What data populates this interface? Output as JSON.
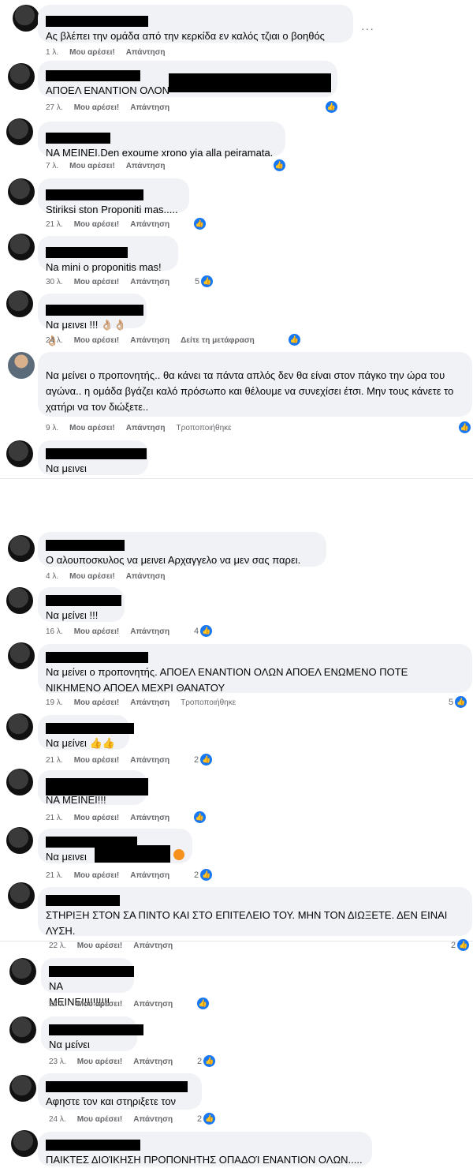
{
  "ui": {
    "like_label": "Μου αρέσει!",
    "reply_label": "Απάντηση",
    "translate_label": "Δείτε τη μετάφραση",
    "edited_label": "Τροποποιήθηκε",
    "more_icon": "···",
    "thumbs_up_icon": "👍"
  },
  "comments": [
    {
      "text": "Ας βλέπει την ομάδα από την κερκίδα εν καλός τζιαι ο βοηθός",
      "time": "1 λ."
    },
    {
      "text": "ΑΠΟΕΛ ΕΝΑΝΤΙΟΝ ΟΛΟΝ",
      "time": "27 λ."
    },
    {
      "text": "ΝΑ ΜΕΙΝΕΙ.Den exoume xrono yia alla peiramata.",
      "time": "7 λ."
    },
    {
      "text": "Stiriksi ston Proponiti mas.....",
      "time": "21 λ."
    },
    {
      "text": "Na mini o proponitis mas!",
      "time": "30 λ.",
      "count": "5"
    },
    {
      "text": "Να μεινει !!! 👌🏼👌🏼👌🏼",
      "time": "24 λ."
    },
    {
      "text": "Να μείνει ο προπονητής.. θα κάνει τα πάντα απλός δεν θα είναι στον πάγκο την ώρα του αγώνα.. η ομάδα βγάζει καλό πρόσωπο και θέλουμε να συνεχίσει έτσι. Μην τους κάνετε το χατήρι να τον διώξετε..",
      "time": "9 λ."
    },
    {
      "text": "Να μεινει"
    },
    {
      "text": "Ο αλουποσκυλος να μεινει Αρχαγγελο να μεν σας παρει.",
      "time": "4 λ."
    },
    {
      "text": "Να μείνει !!!",
      "time": "16 λ.",
      "count": "4"
    },
    {
      "text": "Να μείνει ο προπονητής. ΑΠΟΕΛ ΕΝΑΝΤΙΟΝ ΟΛΩΝ ΑΠΟΕΛ ΕΝΩΜΕΝΟ ΠΟΤΕ ΝΙΚΗΜΕΝΟ ΑΠΟΕΛ ΜΕΧΡΙ ΘΑΝΑΤΟΥ",
      "time": "19 λ.",
      "count": "5"
    },
    {
      "text": "Να μείνει 👍👍",
      "time": "21 λ.",
      "count": "2"
    },
    {
      "text": "ΝΑ ΜΕΙΝΕΙ!!!",
      "time": "21 λ."
    },
    {
      "text": "Να μεινει",
      "time": "21 λ.",
      "count": "2"
    },
    {
      "text": "ΣΤΗΡΙΞΗ ΣΤΟΝ ΣΑ ΠΙΝΤΟ ΚΑΙ ΣΤΟ ΕΠΙΤΕΛΕΙΟ ΤΟΥ. ΜΗΝ ΤΟΝ ΔΙΩΞΕΤΕ. ΔΕΝ ΕΙΝΑΙ ΛΥΣΗ.",
      "time": "22 λ.",
      "count": "2"
    },
    {
      "text": "ΝΑ ΜΕΙΝΕΙ!!!!!!!!!",
      "time": "22 λ."
    },
    {
      "text": "Να μείνει",
      "time": "23 λ.",
      "count": "2"
    },
    {
      "text": "Αφηστε τον και στηριξετε τον",
      "time": "24 λ.",
      "count": "2"
    },
    {
      "text": "ΠΑΙΚΤΕΣ ΔΙΟΊΚΗΣΗ ΠΡΟΠΟΝΗΤΗΣ ΟΠΑΔΟΊ ΕΝΑΝΤΙΟΝ ΟΛΩΝ....."
    }
  ]
}
